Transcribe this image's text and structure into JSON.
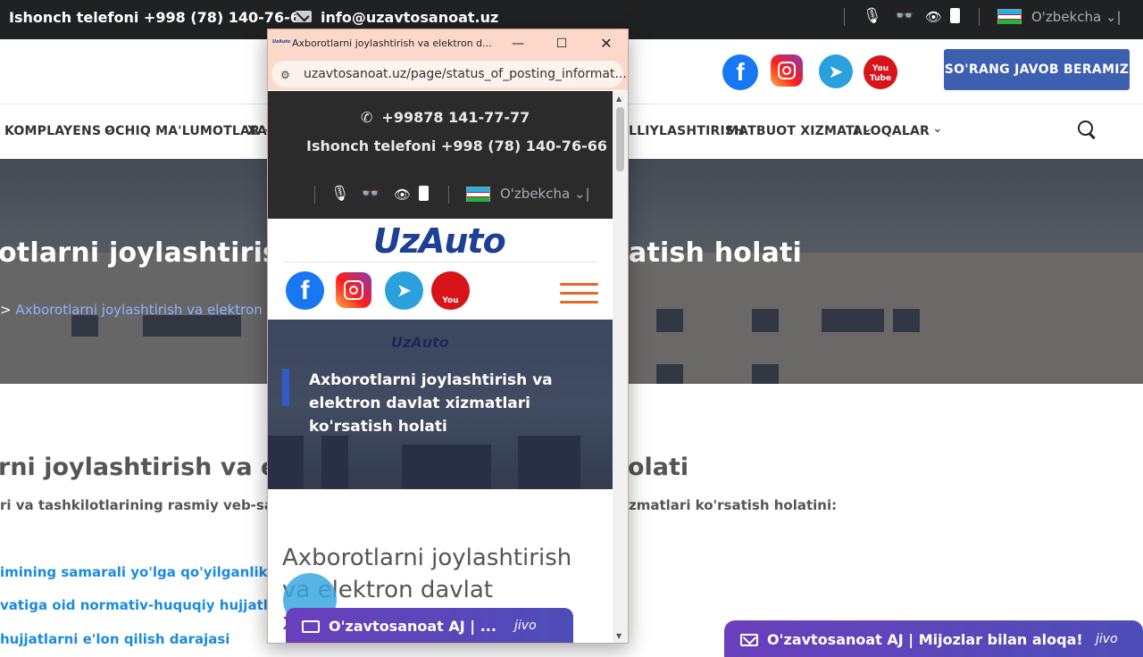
{
  "topbar": {
    "phone": "Ishonch telefoni +998 (78) 140-76-66",
    "email": "info@uzavtosanoat.uz",
    "language": "O'zbekcha"
  },
  "header": {
    "ask_button": "SO'RANG JAVOB BERAMIZ",
    "social": [
      "facebook",
      "instagram",
      "telegram",
      "youtube"
    ],
    "youtube_label": "You Tube"
  },
  "nav": {
    "items": [
      "KOMPLAYENS",
      "OCHIQ MA'LUMOTLAR",
      "XAR",
      "LLIYLASHTIRISH",
      "MATBUOT XIZMATI",
      "ALOQALAR"
    ]
  },
  "hero": {
    "title": "otlarni joylashtirish va e",
    "title_right": "atish holati",
    "breadcrumb": "Axborotlarni joylashtirish va elektron dav"
  },
  "content": {
    "heading_left": "rni joylashtirish va elekt",
    "heading_right": "olati",
    "sub_left": "ri va tashkilotlarining rasmiy veb-saytla",
    "sub_right": "zmatlari ko'rsatish holatini:",
    "links": [
      "imining samarali yo'lga qo'yilganlik dar",
      "vatiga oid normativ-huquqiy hujjatlarni",
      "hujjatlarni e'lon qilish darajasi"
    ]
  },
  "jivo": {
    "text": "O'zavtosanoat AJ | Mijozlar bilan aloqa!",
    "brand": "jivo"
  },
  "popup": {
    "tab_title": "Axborotlarni joylashtirish va elektron d...",
    "favicon_text": "UzAuto",
    "url": "uzavtosanoat.uz/page/status_of_posting_informat...",
    "mobile": {
      "phone1": "+99878 141-77-77",
      "phone2": "Ishonch telefoni +998 (78) 140-76-66",
      "language": "O'zbekcha",
      "logo": "UzAuto",
      "hero_brand": "UzAuto",
      "hero_title": "Axborotlarni joylashtirish va elektron davlat xizmatlari ko'rsatish holati",
      "body_heading": "Axborotlarni joylashtirish va elektron davlat xizmatlari",
      "jivo_text": "O'zavtosanoat AJ | ...",
      "jivo_brand": "jivo"
    }
  },
  "colors": {
    "topbar_bg": "#1f2123",
    "ask_button_bg": "#3d5fb0",
    "link": "#1a8be0",
    "jivo_gradient": "#6a3fbd",
    "burger": "#e06a2c",
    "popup_chrome": "#fbd8c9"
  }
}
